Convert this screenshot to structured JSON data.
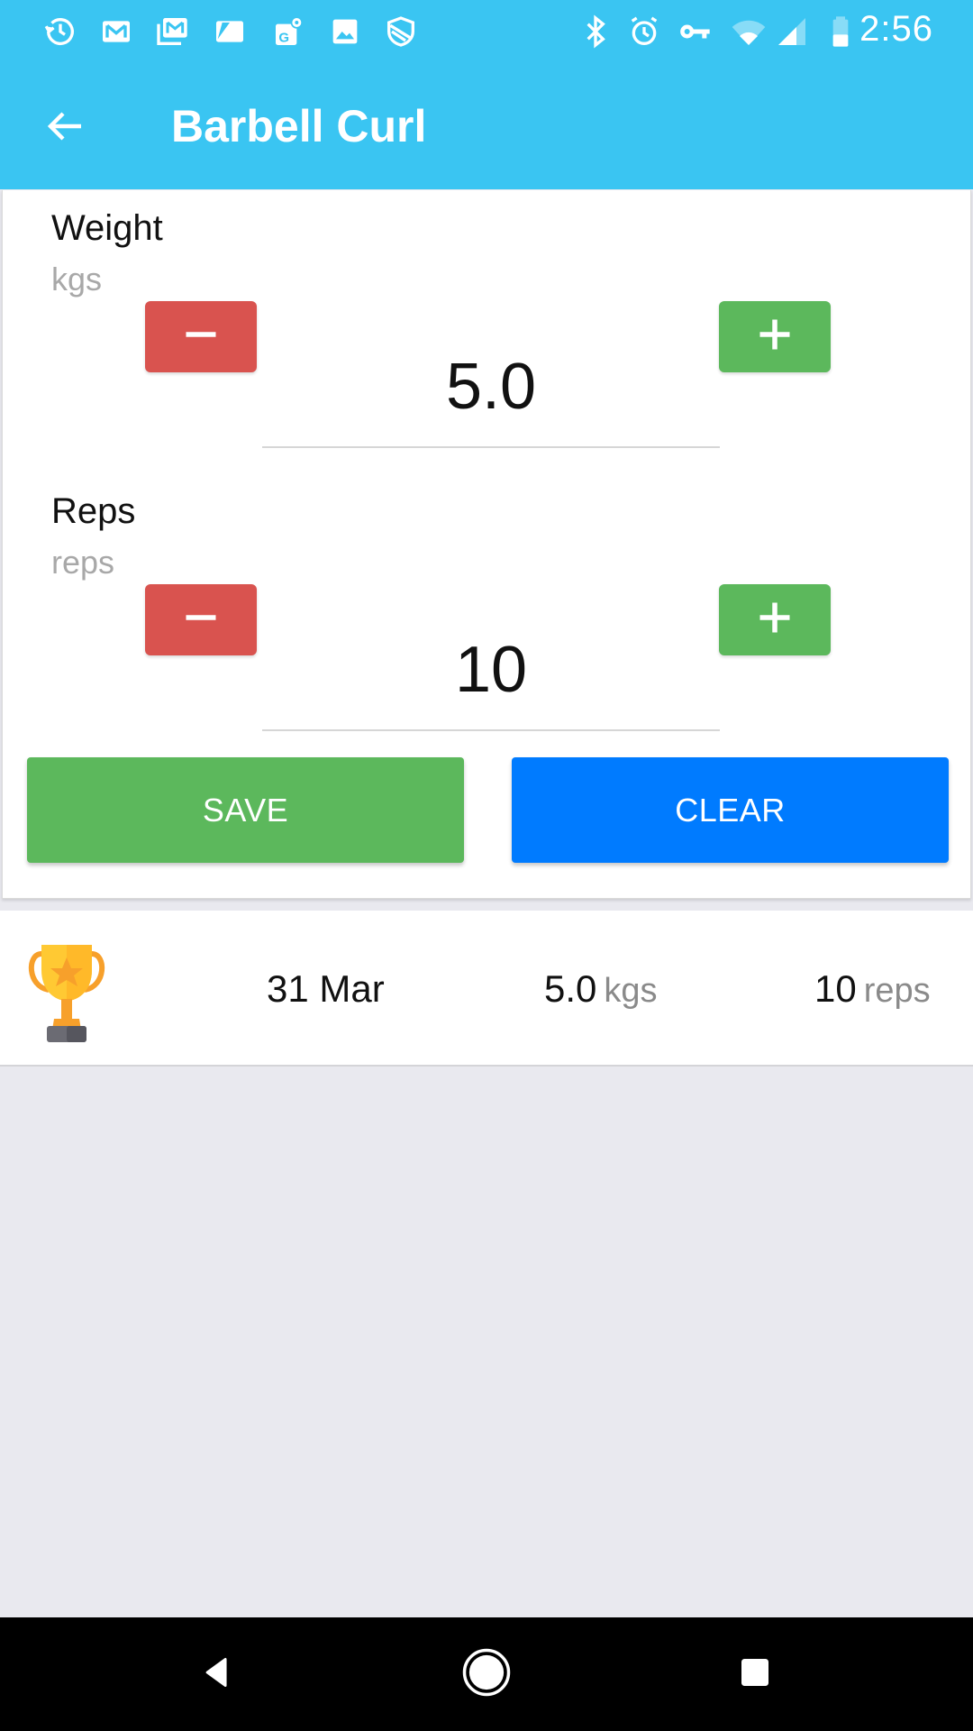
{
  "status_bar": {
    "time": "2:56",
    "left_icons": [
      "history-icon",
      "gmail-icon",
      "gmail-multiple-icon",
      "sheet-icon",
      "maps-icon",
      "image-icon",
      "shield-icon"
    ],
    "right_icons": [
      "bluetooth-icon",
      "alarm-icon",
      "vpn-key-icon",
      "wifi-icon",
      "signal-icon",
      "battery-icon"
    ]
  },
  "app_bar": {
    "title": "Barbell Curl",
    "back_icon": "arrow-back-icon"
  },
  "form": {
    "weight": {
      "label": "Weight",
      "unit": "kgs",
      "value": "5.0",
      "decrement_icon": "minus-icon",
      "increment_icon": "plus-icon"
    },
    "reps": {
      "label": "Reps",
      "unit": "reps",
      "value": "10",
      "decrement_icon": "minus-icon",
      "increment_icon": "plus-icon"
    },
    "save_label": "SAVE",
    "clear_label": "CLEAR"
  },
  "history": [
    {
      "icon": "trophy-icon",
      "date": "31 Mar",
      "weight": "5.0",
      "weight_unit": "kgs",
      "reps": "10",
      "reps_unit": "reps"
    }
  ],
  "colors": {
    "primary": "#3AC5F2",
    "decrement": "#D9534F",
    "increment": "#5CB85C",
    "save": "#5CB85C",
    "clear": "#007BFF",
    "background": "#E9E9EF"
  },
  "nav_bar": {
    "buttons": [
      "back-triangle-icon",
      "home-circle-icon",
      "recents-square-icon"
    ]
  }
}
